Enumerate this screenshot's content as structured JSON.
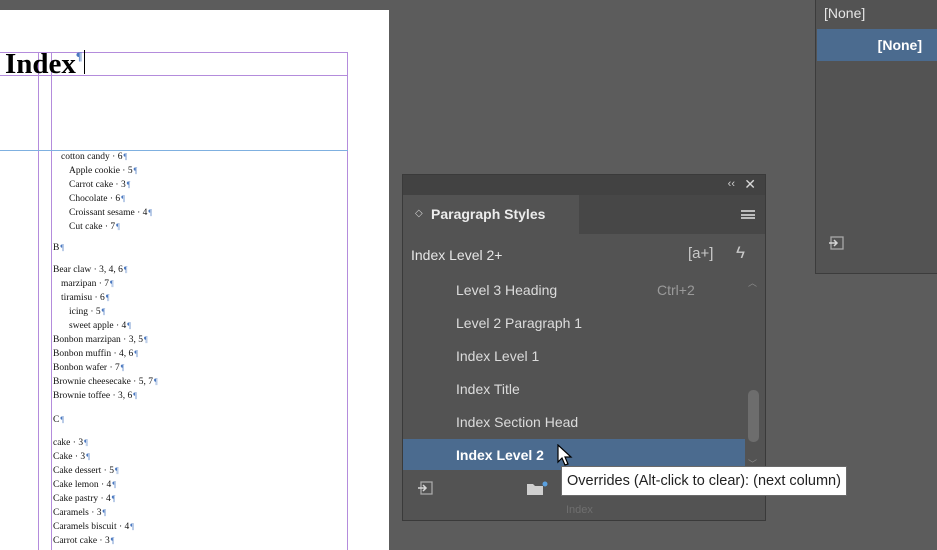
{
  "document": {
    "title": "Index",
    "entries_a": [
      {
        "text": "cotton candy · 6",
        "indent": 1
      },
      {
        "text": "Apple cookie · 5",
        "indent": 2
      },
      {
        "text": "Carrot cake · 3",
        "indent": 2
      },
      {
        "text": "Chocolate · 6",
        "indent": 2
      },
      {
        "text": "Croissant sesame · 4",
        "indent": 2
      },
      {
        "text": "Cut cake · 7",
        "indent": 2
      }
    ],
    "section_b": "B",
    "entries_b": [
      {
        "text": "Bear claw · 3, 4, 6",
        "indent": 0
      },
      {
        "text": "marzipan · 7",
        "indent": 1
      },
      {
        "text": "tiramisu · 6",
        "indent": 1
      },
      {
        "text": "icing · 5",
        "indent": 2
      },
      {
        "text": "sweet apple · 4",
        "indent": 2
      },
      {
        "text": "Bonbon marzipan · 3, 5",
        "indent": 0
      },
      {
        "text": "Bonbon muffin · 4, 6",
        "indent": 0
      },
      {
        "text": "Bonbon wafer · 7",
        "indent": 0
      },
      {
        "text": "Brownie cheesecake · 5, 7",
        "indent": 0
      },
      {
        "text": "Brownie toffee · 3, 6",
        "indent": 0
      }
    ],
    "section_c": "C",
    "entries_c": [
      {
        "text": "cake · 3",
        "indent": 0
      },
      {
        "text": "Cake · 3",
        "indent": 0
      },
      {
        "text": "Cake dessert · 5",
        "indent": 0
      },
      {
        "text": "Cake lemon · 4",
        "indent": 0
      },
      {
        "text": "Cake pastry · 4",
        "indent": 0
      },
      {
        "text": "Caramels · 3",
        "indent": 0
      },
      {
        "text": "Caramels biscuit · 4",
        "indent": 0
      },
      {
        "text": "Carrot cake · 3",
        "indent": 0
      }
    ]
  },
  "right_panel": {
    "none_label": "[None]",
    "selected_label": "[None]"
  },
  "paragraph_styles": {
    "tab_label": "Paragraph Styles",
    "current_style": "Index Level 2+",
    "new_style_button": "[a+]",
    "items": [
      {
        "label": "Level 3 Heading",
        "shortcut": "Ctrl+2"
      },
      {
        "label": "Level 2 Paragraph 1",
        "shortcut": ""
      },
      {
        "label": "Index Level 1",
        "shortcut": ""
      },
      {
        "label": "Index Title",
        "shortcut": ""
      },
      {
        "label": "Index Section Head",
        "shortcut": ""
      },
      {
        "label": "Index Level 2",
        "shortcut": ""
      }
    ],
    "selected_index": 5,
    "footer_hint": "Index"
  },
  "tooltip": {
    "text": "Overrides (Alt-click to clear):  (next column)"
  },
  "colors": {
    "accent": "#4b6b8f",
    "panel_bg": "#535353",
    "workspace_bg": "#5c5c5c"
  }
}
